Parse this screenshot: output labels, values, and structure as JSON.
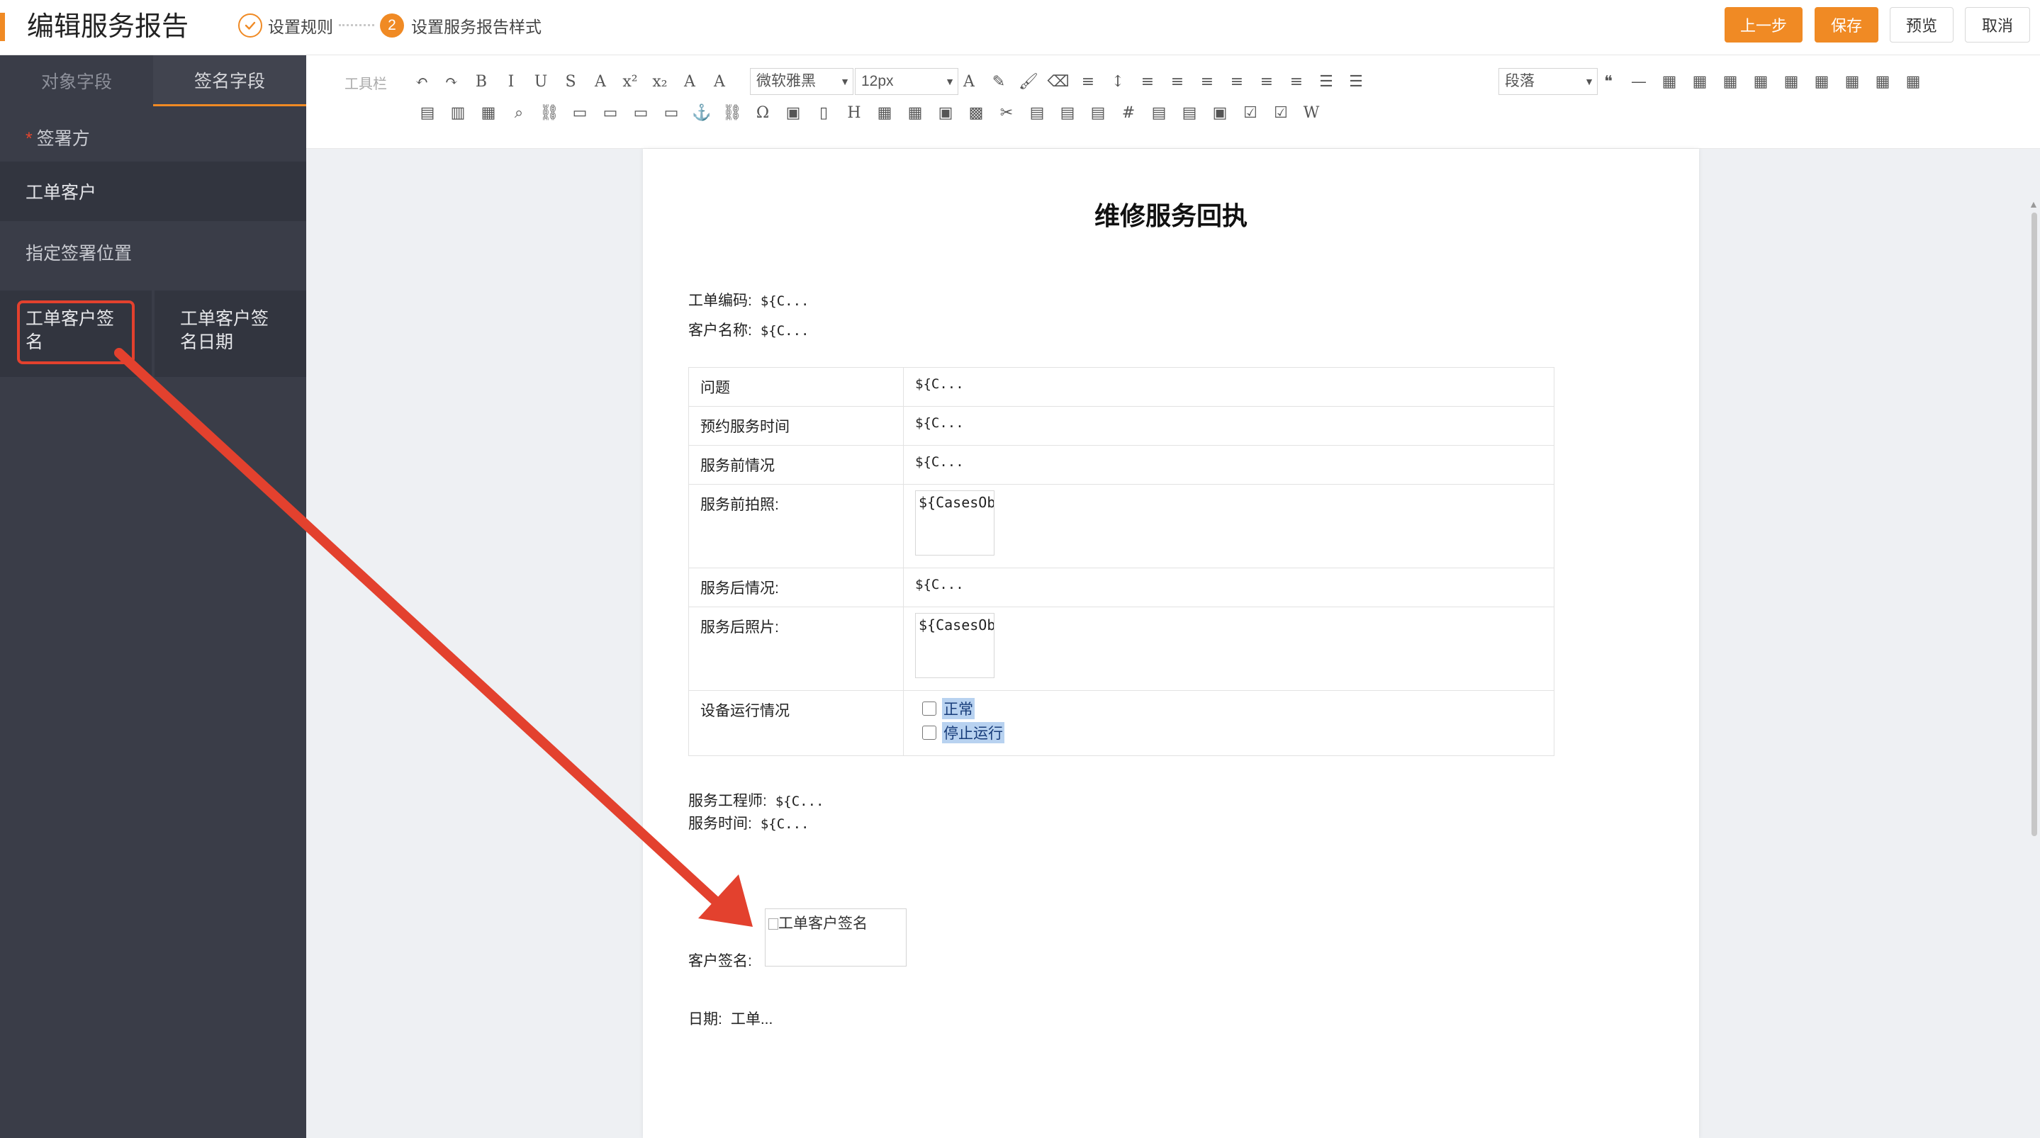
{
  "header": {
    "title": "编辑服务报告",
    "steps": [
      {
        "label": "设置规则",
        "state": "done"
      },
      {
        "number": "2",
        "label": "设置服务报告样式",
        "state": "active"
      }
    ],
    "buttons": {
      "prev": "上一步",
      "save": "保存",
      "preview": "预览",
      "cancel": "取消"
    }
  },
  "sidebar": {
    "tabs": [
      "对象字段",
      "签名字段"
    ],
    "active_tab": "签名字段",
    "signer_label": "签署方",
    "signer_value": "工单客户",
    "position_label": "指定签署位置",
    "fields": [
      "工单客户签名",
      "工单客户签名日期"
    ]
  },
  "toolbar": {
    "label": "工具栏",
    "font_family": "微软雅黑",
    "font_size": "12px",
    "paragraph": "段落"
  },
  "document": {
    "title": "维修服务回执",
    "order_code_label": "工单编码:",
    "order_code_value": "${C...",
    "customer_label": "客户名称:",
    "customer_value": "${C...",
    "rows": [
      {
        "label": "问题",
        "value": "${C..."
      },
      {
        "label": "预约服务时间",
        "value": "${C..."
      },
      {
        "label": "服务前情况",
        "value": "${C..."
      },
      {
        "label": "服务前拍照:",
        "image_alt": "${CasesObj.field_xcpz__c}"
      },
      {
        "label": "服务后情况:",
        "value": "${C..."
      },
      {
        "label": "服务后照片:",
        "image_alt": "${CasesObj.field_photos_afte"
      },
      {
        "label": "设备运行情况",
        "options": [
          "正常",
          "停止运行"
        ]
      }
    ],
    "engineer_label": "服务工程师:",
    "engineer_value": "${C...",
    "service_time_label": "服务时间:",
    "service_time_value": "${C...",
    "signature_label": "客户签名:",
    "signature_alt": "工单客户签名",
    "date_label": "日期:",
    "date_value": "工单..."
  },
  "colors": {
    "accent": "#f08a24",
    "sidebar_bg": "#3a3d48",
    "annotation": "#e3412e"
  }
}
